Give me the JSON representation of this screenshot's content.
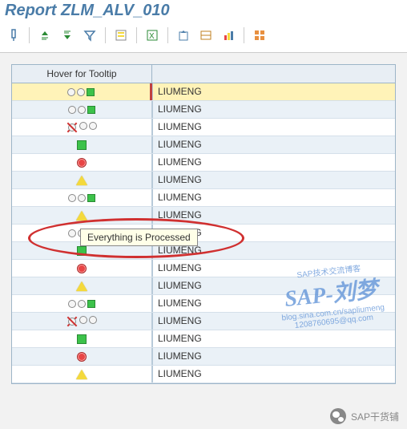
{
  "title": "Report ZLM_ALV_010",
  "toolbar": {
    "icons": [
      "detail-icon",
      "sort-asc-icon",
      "sort-desc-icon",
      "filter-icon",
      "layout-icon",
      "excel-icon",
      "export-icon",
      "abc-icon",
      "chart-icon",
      "grid-icon"
    ]
  },
  "grid": {
    "header_icon": "Hover for Tooltip",
    "header_text": "",
    "rows": [
      {
        "icon": "traffic-green-sq",
        "text": "LIUMENG",
        "selected": true
      },
      {
        "icon": "traffic-green-sq",
        "text": "LIUMENG"
      },
      {
        "icon": "cross-circle",
        "text": "LIUMENG"
      },
      {
        "icon": "sq-green",
        "text": "LIUMENG"
      },
      {
        "icon": "diamond-red",
        "text": "LIUMENG"
      },
      {
        "icon": "tri-yellow",
        "text": "LIUMENG"
      },
      {
        "icon": "traffic-green-sq",
        "text": "LIUMENG"
      },
      {
        "icon": "tri-yellow",
        "text": "LIUMENG"
      },
      {
        "icon": "traffic-green-sq",
        "text": "LIUMENG"
      },
      {
        "icon": "sq-green",
        "text": "LIUMENG"
      },
      {
        "icon": "diamond-red",
        "text": "LIUMENG"
      },
      {
        "icon": "tri-yellow",
        "text": "LIUMENG"
      },
      {
        "icon": "traffic-green-sq",
        "text": "LIUMENG"
      },
      {
        "icon": "cross-circle",
        "text": "LIUMENG"
      },
      {
        "icon": "sq-green",
        "text": "LIUMENG"
      },
      {
        "icon": "diamond-red",
        "text": "LIUMENG"
      },
      {
        "icon": "tri-yellow",
        "text": "LIUMENG"
      }
    ]
  },
  "tooltip": "Everything is Processed",
  "watermark": {
    "top": "SAP技术交流博客",
    "main": "SAP-刘梦",
    "blog": "blog.sina.com.cn/sapliumeng",
    "email": "1208760695@qq.com"
  },
  "wechat": "SAP干货铺"
}
